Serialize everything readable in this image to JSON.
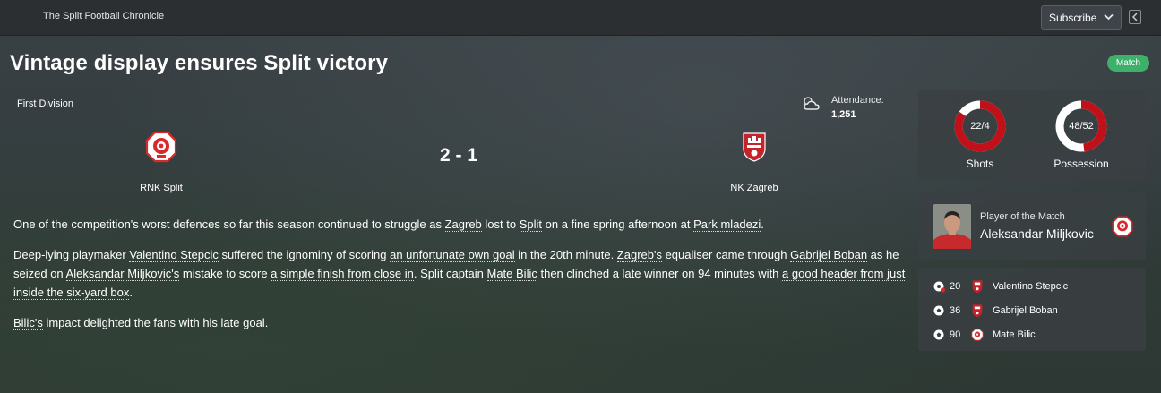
{
  "topbar": {
    "publication": "The Split Football Chronicle",
    "subscribe_label": "Subscribe"
  },
  "article": {
    "headline": "Vintage display ensures Split victory",
    "tag": "Match",
    "paragraph1": {
      "t1": "One of the competition's worst defences so far this season continued to struggle as ",
      "l1": "Zagreb",
      "t2": " lost to ",
      "l2": "Split",
      "t3": " on a fine spring afternoon at ",
      "l3": "Park mladezi",
      "t4": "."
    },
    "paragraph2": {
      "t1": "Deep-lying playmaker ",
      "l1": "Valentino Stepcic",
      "t2": " suffered the ignominy of scoring ",
      "l2": "an unfortunate own goal",
      "t3": " in the 20th minute. ",
      "l3": "Zagreb's",
      "t4": " equaliser came through ",
      "l4": "Gabrijel Boban",
      "t5": " as he seized on ",
      "l5": "Aleksandar Miljkovic's",
      "t6": " mistake to score ",
      "l6": "a simple finish from close in",
      "t7": ". Split captain ",
      "l7": "Mate Bilic",
      "t8": " then clinched a late winner on 94 minutes with ",
      "l8": "a good header from just inside the six-yard box",
      "t9": "."
    },
    "paragraph3": {
      "l1": "Bilic's",
      "t1": " impact delighted the fans with his late goal."
    }
  },
  "match": {
    "competition": "First Division",
    "attendance_label": "Attendance:",
    "attendance_value": "1,251",
    "score": "2 - 1",
    "home_team": "RNK Split",
    "away_team": "NK Zagreb",
    "home_color": "#d72a2a",
    "away_color": "#c8232b"
  },
  "stats": {
    "shots_label": "22/4",
    "shots_caption": "Shots",
    "shots_home": 22,
    "shots_away": 4,
    "possession_label": "48/52",
    "possession_caption": "Possession",
    "possession_home": 48,
    "possession_away": 52,
    "home_ring_color": "#c0111a",
    "away_ring_color": "#ffffff"
  },
  "potm": {
    "label": "Player of the Match",
    "name": "Aleksandar Miljkovic"
  },
  "goals": [
    {
      "minute": "20",
      "scorer": "Valentino Stepcic",
      "type": "own-goal",
      "team": "away"
    },
    {
      "minute": "36",
      "scorer": "Gabrijel Boban",
      "type": "goal",
      "team": "away"
    },
    {
      "minute": "90",
      "scorer": "Mate Bilic",
      "type": "goal",
      "team": "home"
    }
  ]
}
